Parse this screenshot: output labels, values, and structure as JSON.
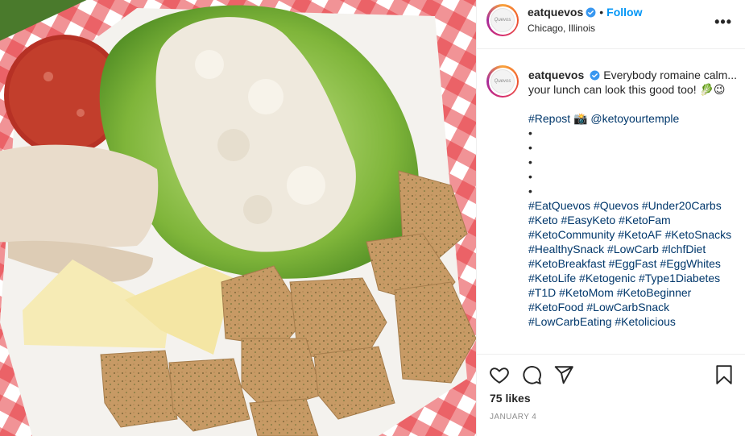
{
  "post": {
    "photo_alt": "Keto snack plate with chicken salad on romaine, pepperoni, turkey slices, cheese wedges and crackers",
    "author": {
      "username": "eatquevos",
      "verified": true,
      "location": "Chicago, Illinois",
      "avatar_text": "Quevos"
    },
    "follow_label": "Follow",
    "separator": "•",
    "more_icon": "more-horizontal-icon",
    "more_label": "•••",
    "caption": {
      "username": "eatquevos",
      "text": "Everybody romaine calm... your lunch can look this good too! 🥬😉",
      "repost_line": "#Repost 📸 @ketoyourtemple",
      "bullets": [
        "•",
        "•",
        "•",
        "•",
        "•"
      ],
      "hashtags": "#EatQuevos #Quevos #Under20Carbs #Keto #EasyKeto #KetoFam #KetoCommunity #KetoAF #KetoSnacks #HealthySnack #LowCarb #lchfDiet #KetoBreakfast #EggFast #EggWhites #KetoLife #Ketogenic #Type1Diabetes #T1D #KetoMom #KetoBeginner #KetoFood #LowCarbSnack #LowCarbEating #Ketolicious"
    },
    "actions": {
      "like_icon": "heart-icon",
      "comment_icon": "comment-icon",
      "share_icon": "share-icon",
      "save_icon": "bookmark-icon"
    },
    "likes": "75 likes",
    "date": "JANUARY 4"
  },
  "colors": {
    "link_blue": "#0095f6",
    "hashtag_blue": "#00376b",
    "muted_gray": "#8e8e8e",
    "border": "#efefef"
  }
}
